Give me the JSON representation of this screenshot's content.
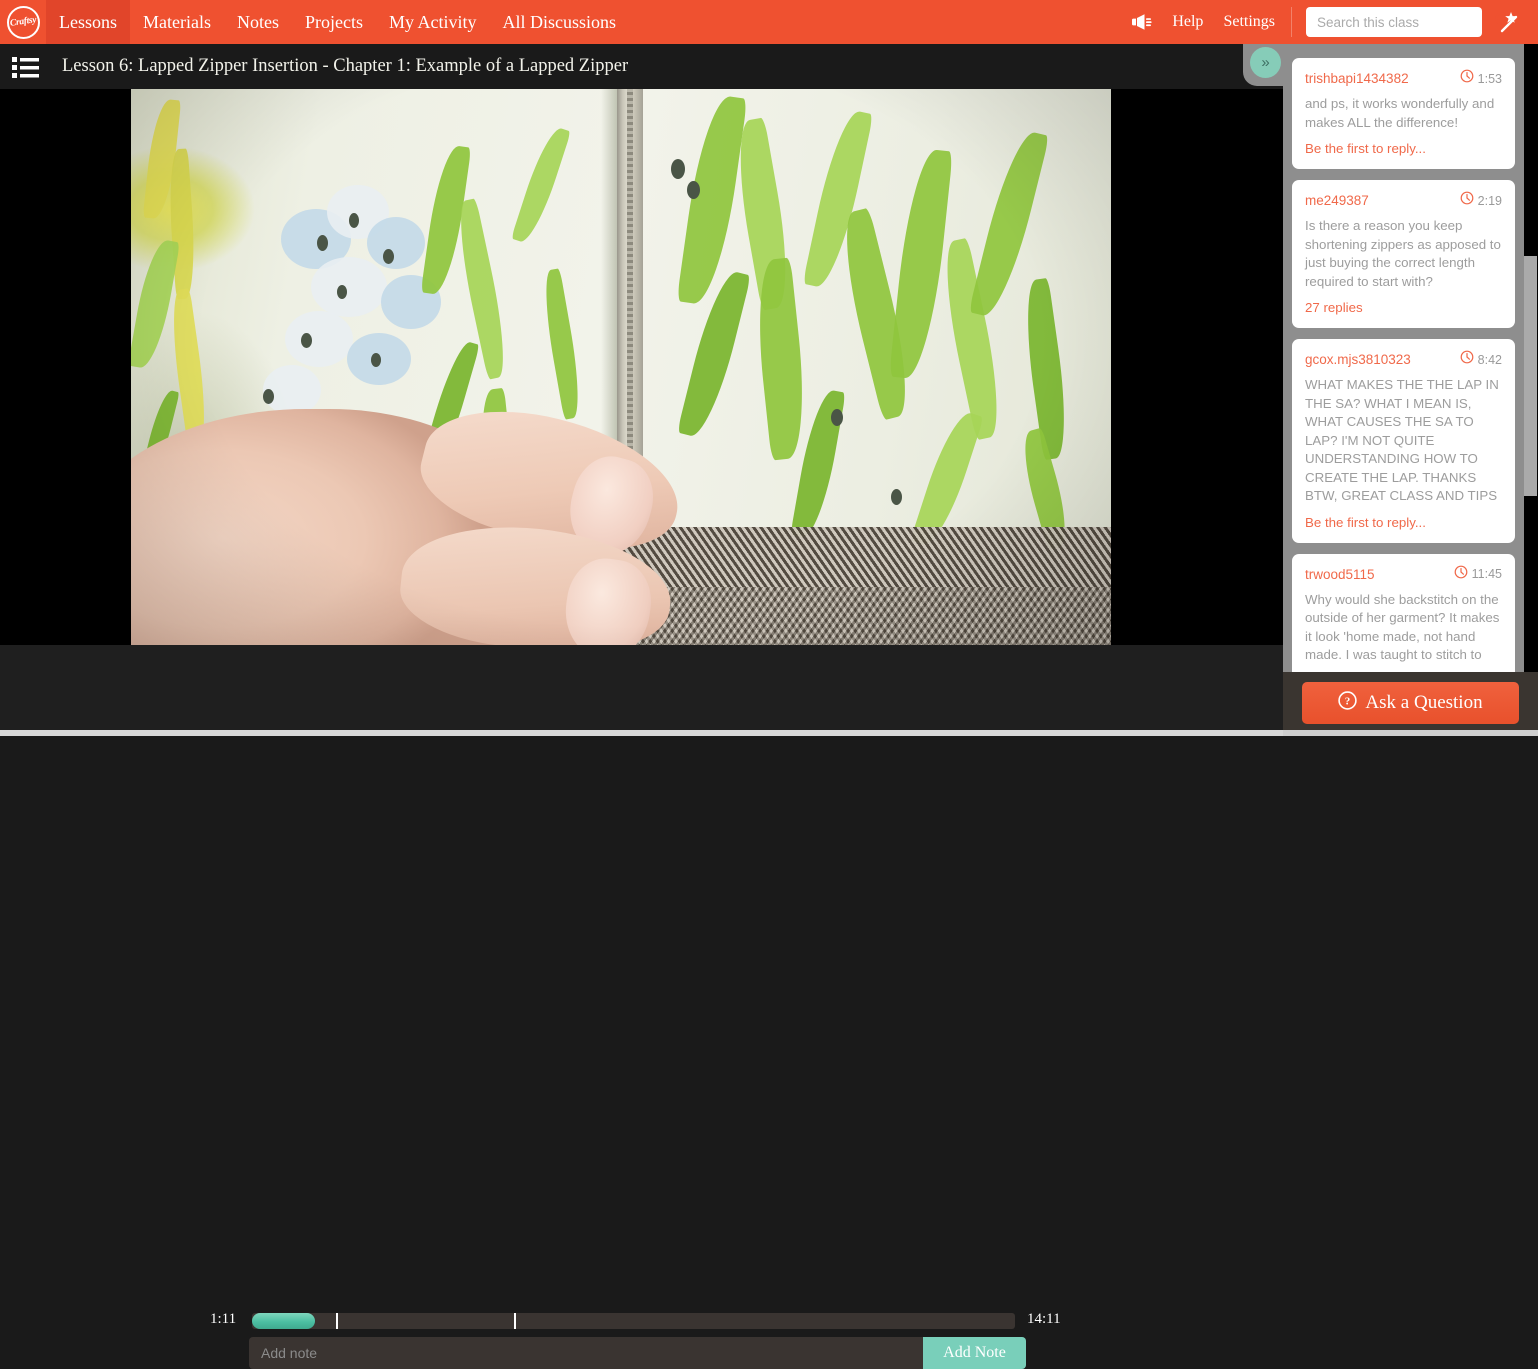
{
  "brand": {
    "logo_text": "Craftsy",
    "accent_orange": "#ef5130",
    "accent_teal": "#79cfba",
    "sidebar_gray": "#8e8e8e"
  },
  "topnav": {
    "items": [
      {
        "label": "Lessons",
        "active": true
      },
      {
        "label": "Materials",
        "active": false
      },
      {
        "label": "Notes",
        "active": false
      },
      {
        "label": "Projects",
        "active": false
      },
      {
        "label": "My Activity",
        "active": false
      },
      {
        "label": "All Discussions",
        "active": false
      }
    ],
    "megaphone_icon": "megaphone-icon",
    "help_label": "Help",
    "settings_label": "Settings",
    "search_placeholder": "Search this class",
    "search_value": "",
    "search_icon": "search-icon",
    "wand_icon": "magic-wand-icon"
  },
  "titlebar": {
    "list_icon": "lesson-list-icon",
    "title": "Lesson 6: Lapped Zipper Insertion - Chapter 1: Example of a Lapped Zipper",
    "collapse_icon": "»"
  },
  "player": {
    "current_time": "1:11",
    "total_time": "14:11",
    "progress_percent": 8.3,
    "chapter_markers_percent": [
      11.0,
      34.3
    ],
    "note_placeholder": "Add note",
    "note_value": "",
    "add_note_label": "Add Note"
  },
  "sidebar": {
    "comments": [
      {
        "user": "trishbapi1434382",
        "time": "1:53",
        "clock_icon": "clock-icon",
        "body": "and ps, it works wonderfully and makes ALL the difference!",
        "reply_label": "Be the first to reply..."
      },
      {
        "user": "me249387",
        "time": "2:19",
        "clock_icon": "clock-icon",
        "body": "Is there a reason you keep shortening zippers as apposed to just buying the correct length required to start with?",
        "reply_label": "27 replies"
      },
      {
        "user": "gcox.mjs3810323",
        "time": "8:42",
        "clock_icon": "clock-icon",
        "body": "WHAT MAKES THE THE LAP IN THE SA? WHAT I MEAN IS, WHAT CAUSES THE SA TO LAP? I'M NOT QUITE UNDERSTANDING HOW TO CREATE THE LAP. THANKS BTW, GREAT CLASS AND TIPS",
        "reply_label": "Be the first to reply..."
      },
      {
        "user": "trwood5115",
        "time": "11:45",
        "clock_icon": "clock-icon",
        "body": "Why would she backstitch on the outside of her garment? It makes it look 'home made, not hand made. I was taught to stitch to",
        "reply_label": ""
      }
    ],
    "ask_button_label": "Ask a Question",
    "ask_button_icon": "question-circle-icon"
  }
}
